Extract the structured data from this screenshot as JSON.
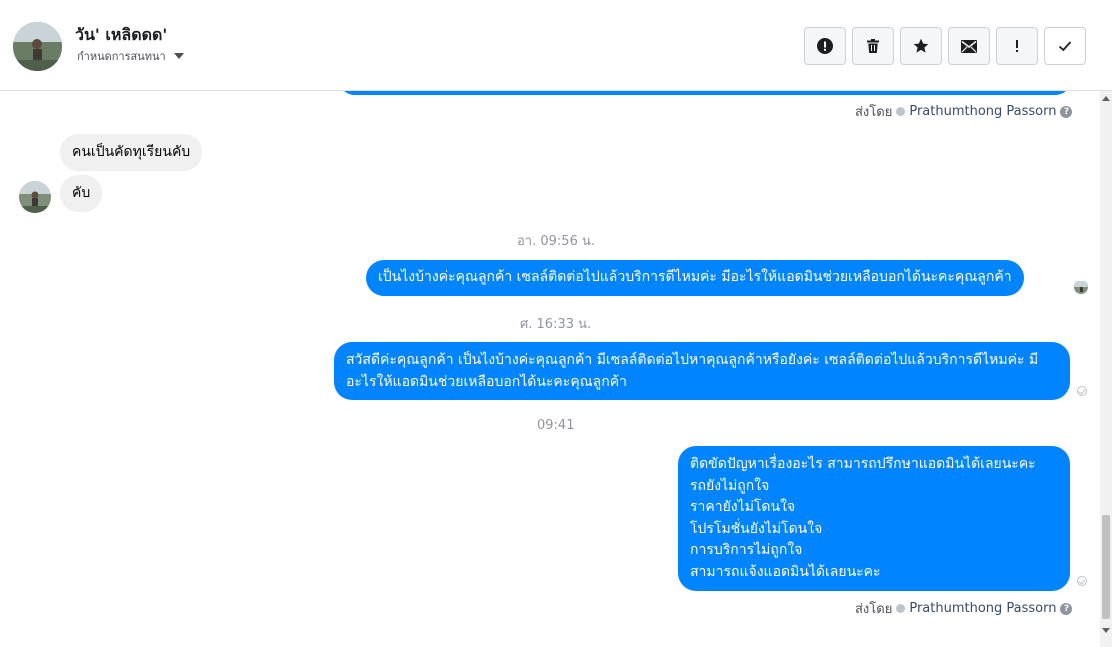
{
  "header": {
    "contact_name": "วัน' เหลิดดด'",
    "assign_label": "กำหนดการสนทนา"
  },
  "toolbar": {
    "buttons": [
      {
        "icon": "alert-circle-icon"
      },
      {
        "icon": "trash-icon"
      },
      {
        "icon": "star-icon"
      },
      {
        "icon": "envelope-icon"
      },
      {
        "icon": "exclamation-icon"
      },
      {
        "icon": "check-icon"
      }
    ]
  },
  "conversation": {
    "sent_by_top": {
      "label": "ส่งโดย",
      "name": "Prathumthong Passorn"
    },
    "incoming": [
      {
        "text": "คนเป็นคัดทุเรียนคับ"
      },
      {
        "text": "คับ"
      }
    ],
    "timestamps": [
      "อา. 09:56 น.",
      "ศ. 16:33 น.",
      "09:41"
    ],
    "outgoing": [
      {
        "text": "เป็นไงบ้างค่ะคุณลูกค้า เซลล์ติดต่อไปแล้วบริการดีไหมค่ะ มีอะไรให้แอดมินช่วยเหลือบอกได้นะคะคุณลูกค้า"
      },
      {
        "text": "สวัสดีค่ะคุณลูกค้า เป็นไงบ้างค่ะคุณลูกค้า มีเซลล์ติดต่อไปหาคุณลูกค้าหรือยังค่ะ  เซลล์ติดต่อไปแล้วบริการดีไหมค่ะ มีอะไรให้แอดมินช่วยเหลือบอกได้นะคะคุณลูกค้า"
      },
      {
        "lines": [
          "ติดขัดปัญหาเรื่องอะไร สามารถปรึกษาแอดมินได้เลยนะคะ",
          "รถยังไม่ถูกใจ",
          "ราคายังไม่โดนใจ",
          "โปรโมชั่นยังไม่โดนใจ",
          "การบริการไม่ถูกใจ",
          "สามารถแจ้งแอดมินได้เลยนะคะ"
        ]
      }
    ],
    "sent_by_bottom": {
      "label": "ส่งโดย",
      "name": "Prathumthong Passorn"
    }
  },
  "colors": {
    "outgoing_bubble": "#0084ff",
    "incoming_bubble": "#f1f0f0",
    "timestamp": "#90949c"
  }
}
